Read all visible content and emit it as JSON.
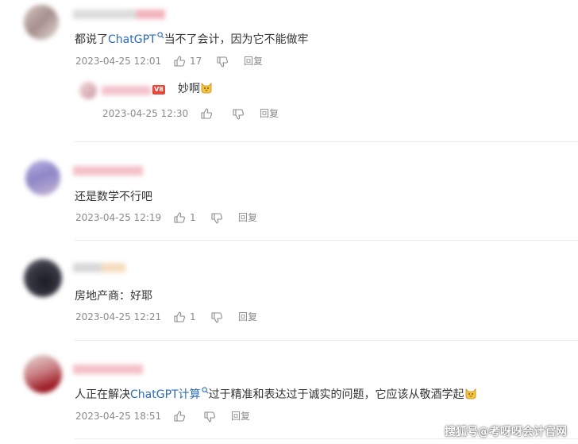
{
  "comments": [
    {
      "text_before": "都说了",
      "link": "ChatGPT",
      "text_after": "当不了会计，因为它不能做牢",
      "time": "2023-04-25 12:01",
      "likes": "17",
      "reply_label": "回复",
      "reply": {
        "text": "妙啊",
        "badge": "V8",
        "time": "2023-04-25 12:30",
        "reply_label": "回复"
      }
    },
    {
      "text": "还是数学不行吧",
      "time": "2023-04-25 12:19",
      "likes": "1",
      "reply_label": "回复"
    },
    {
      "text": "房地产商：好耶",
      "time": "2023-04-25 12:21",
      "likes": "1",
      "reply_label": "回复"
    },
    {
      "text_before": "人正在解决",
      "link": "ChatGPT计算",
      "text_after": "过于精准和表达过于诚实的问题，它应该从敬酒学起",
      "time": "2023-04-25 18:51",
      "likes": "",
      "reply_label": "回复"
    }
  ],
  "watermark": "搜狐号@考呀呀会计官网",
  "colors": {
    "link": "#2a6bbd",
    "meta": "#8a8a8a",
    "badge": "#e8473a"
  }
}
